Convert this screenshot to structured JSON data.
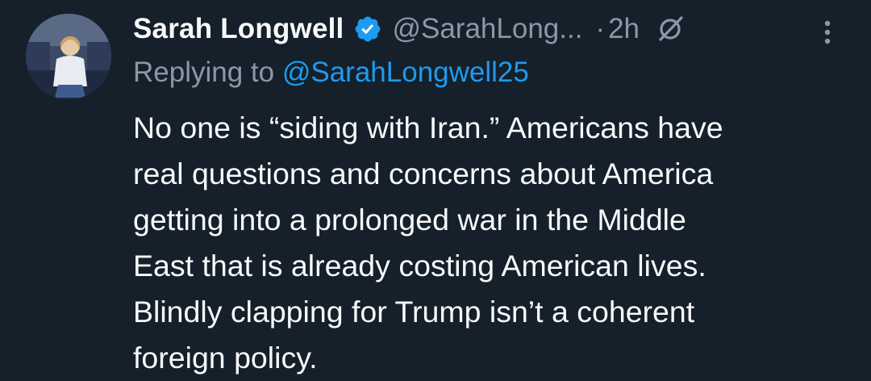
{
  "tweet": {
    "author": {
      "display_name": "Sarah Longwell",
      "handle": "@SarahLong...",
      "verified": true,
      "avatar_icon": "profile-photo"
    },
    "separator": "·",
    "time": "2h",
    "reply": {
      "prefix": "Replying to",
      "handle": "@SarahLongwell25"
    },
    "body_lines": [
      "No one is “siding with Iran.” Americans have",
      "real questions and concerns about America",
      "getting into a prolonged war in the Middle",
      "East that is already costing American lives.",
      "Blindly clapping for Trump isn’t a coherent",
      "foreign policy."
    ],
    "icons": {
      "verified": "verified-badge-icon",
      "grok": "grok-icon",
      "more": "more-options-icon"
    }
  },
  "colors": {
    "background": "#15202b",
    "text": "#f7f9f9",
    "secondary": "#8b98a5",
    "accent": "#1d9bf0"
  }
}
